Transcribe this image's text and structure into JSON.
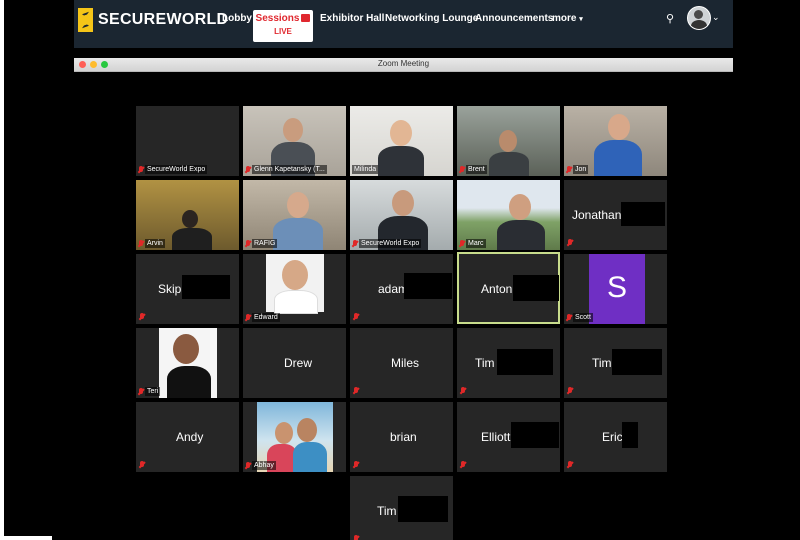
{
  "nav": {
    "logo_text": "SECUREWORLD",
    "items": {
      "lobby": "Lobby",
      "sessions": "Sessions",
      "sessions_badge": "LIVE",
      "exhibitor": "Exhibitor Hall",
      "networking": "Networking Lounge",
      "announcements": "Announcements",
      "more": "more"
    },
    "search_icon": "search-icon",
    "avatar_icon": "user-avatar"
  },
  "window": {
    "title": "Zoom Meeting",
    "controls": {
      "close": "#ff5f57",
      "minimize": "#febc2e",
      "zoom": "#28c840"
    }
  },
  "participants": [
    {
      "label": "SecureWorld Expo"
    },
    {
      "label": "Glenn Kapetansky (T..."
    },
    {
      "label": "Milinda"
    },
    {
      "label": "Brent"
    },
    {
      "label": "Jon"
    },
    {
      "label": "Arvin"
    },
    {
      "label": "RAFIG"
    },
    {
      "label": "SecureWorld Expo"
    },
    {
      "label": "Marc"
    },
    {
      "name": "Jonathan"
    },
    {
      "name": "Skip"
    },
    {
      "label": "Edward"
    },
    {
      "name": "adam"
    },
    {
      "name": "Anton"
    },
    {
      "initial": "S",
      "label": "Scott"
    },
    {
      "label": "Teri"
    },
    {
      "name": "Drew"
    },
    {
      "name": "Miles"
    },
    {
      "name": "Tim"
    },
    {
      "name": "Tim"
    },
    {
      "name": "Andy"
    },
    {
      "label": "Abhay"
    },
    {
      "name": "brian"
    },
    {
      "name": "Elliott"
    },
    {
      "name": "Eric"
    },
    {
      "name": "Tim"
    }
  ],
  "colors": {
    "nav_bg": "#1b2631",
    "accent": "#e0282f",
    "logo": "#f5c518",
    "active_speaker": "#c8dc8c",
    "scott_avatar": "#6f2fc4"
  }
}
